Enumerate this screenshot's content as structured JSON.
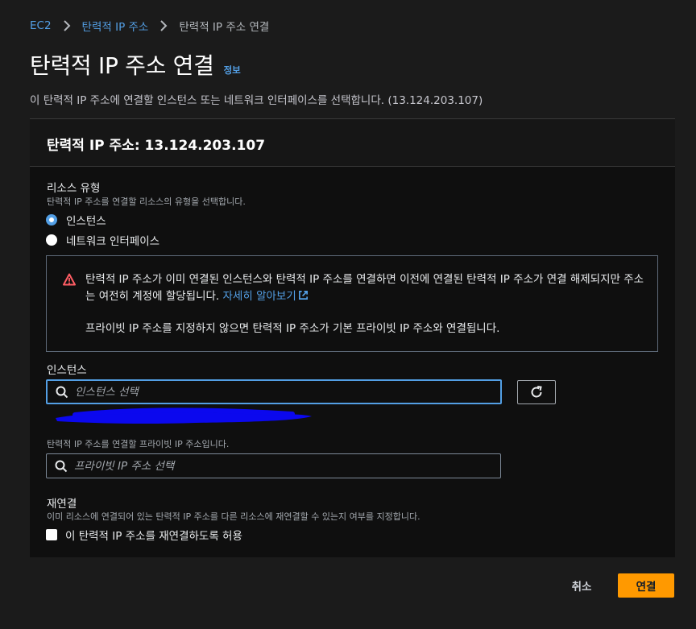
{
  "breadcrumb": {
    "items": [
      "EC2",
      "탄력적 IP 주소",
      "탄력적 IP 주소 연결"
    ]
  },
  "header": {
    "title": "탄력적 IP 주소 연결",
    "info": "정보",
    "description": "이 탄력적 IP 주소에 연결할 인스턴스 또는 네트워크 인터페이스를 선택합니다. (13.124.203.107)"
  },
  "panel": {
    "title": "탄력적 IP 주소: 13.124.203.107"
  },
  "resource_type": {
    "label": "리소스 유형",
    "description": "탄력적 IP 주소를 연결할 리소스의 유형을 선택합니다.",
    "options": [
      "인스턴스",
      "네트워크 인터페이스"
    ],
    "selected": "인스턴스"
  },
  "alert": {
    "text1": "탄력적 IP 주소가 이미 연결된 인스턴스와 탄력적 IP 주소를 연결하면 이전에 연결된 탄력적 IP 주소가 연결 해제되지만 주소는 여전히 계정에 할당됩니다.",
    "link": "자세히 알아보기",
    "text2": "프라이빗 IP 주소를 지정하지 않으면 탄력적 IP 주소가 기본 프라이빗 IP 주소와 연결됩니다."
  },
  "instance": {
    "label": "인스턴스",
    "placeholder": "인스턴스 선택"
  },
  "private_ip": {
    "description": "탄력적 IP 주소를 연결할 프라이빗 IP 주소입니다.",
    "placeholder": "프라이빗 IP 주소 선택"
  },
  "reassociation": {
    "label": "재연결",
    "description": "이미 리소스에 연결되어 있는 탄력적 IP 주소를 다른 리소스에 재연결할 수 있는지 여부를 지정합니다.",
    "checkbox_label": "이 탄력적 IP 주소를 재연결하도록 허용"
  },
  "footer": {
    "cancel": "취소",
    "submit": "연결"
  },
  "colors": {
    "accent": "#539fe5",
    "primary": "#ff9900",
    "warning": "#ff5d64"
  }
}
